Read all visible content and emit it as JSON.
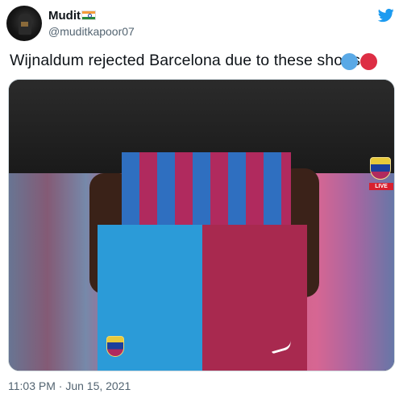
{
  "user": {
    "name": "Mudit",
    "handle": "@muditkapoor07",
    "flag": "india-flag-emoji"
  },
  "tweet": {
    "text": "Wijnaldum rejected Barcelona due to these shorts",
    "emojis": [
      "blue-circle",
      "red-circle"
    ]
  },
  "media": {
    "description_icons": [
      "fc-barcelona-crest",
      "nike-swoosh"
    ],
    "live_badge": "LIVE"
  },
  "meta": {
    "timestamp": "11:03 PM · Jun 15, 2021"
  },
  "colors": {
    "twitter_blue": "#1d9bf0",
    "handle_gray": "#536471",
    "text_dark": "#0f1419",
    "blue_circle": "#5aa9e6",
    "red_circle": "#dd2e44"
  },
  "icons": {
    "platform": "twitter-bird-icon"
  }
}
